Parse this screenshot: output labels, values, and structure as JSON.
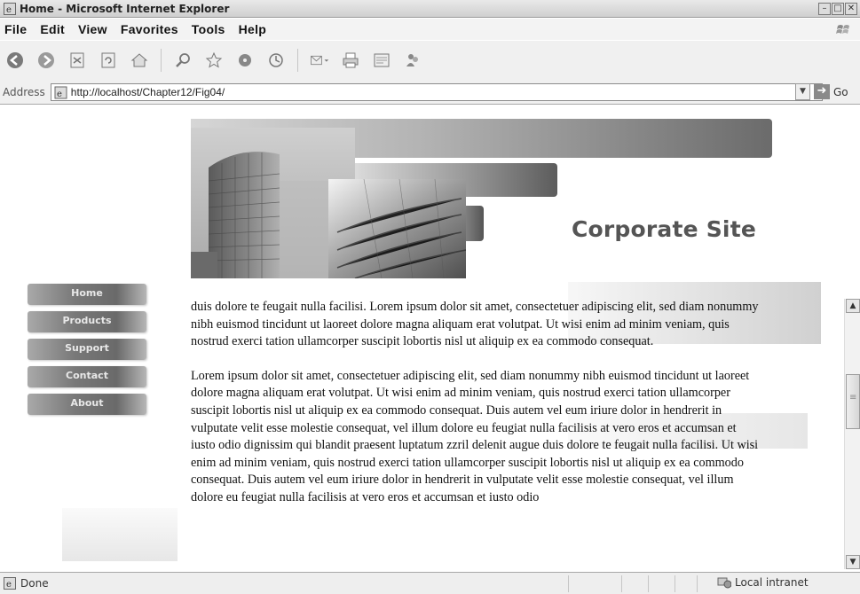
{
  "window": {
    "title": "Home - Microsoft Internet Explorer",
    "controls": [
      "–",
      "□",
      "✕"
    ]
  },
  "menu": [
    "File",
    "Edit",
    "View",
    "Favorites",
    "Tools",
    "Help"
  ],
  "toolbar": {
    "icons": [
      "back-icon",
      "forward-icon",
      "stop-icon",
      "refresh-icon",
      "home-icon",
      "search-icon",
      "favorites-icon",
      "media-icon",
      "history-icon",
      "mail-icon",
      "print-icon",
      "edit-icon",
      "messenger-icon"
    ]
  },
  "address": {
    "label": "Address",
    "url": "http://localhost/Chapter12/Fig04/",
    "go_label": "Go"
  },
  "banner": {
    "title": "Corporate Site"
  },
  "nav": [
    {
      "label": "Home"
    },
    {
      "label": "Products"
    },
    {
      "label": "Support"
    },
    {
      "label": "Contact"
    },
    {
      "label": "About"
    }
  ],
  "content": {
    "paragraphs": [
      "duis dolore te feugait nulla facilisi. Lorem ipsum dolor sit amet, consectetuer adipiscing elit, sed diam nonummy nibh euismod tincidunt ut laoreet dolore magna aliquam erat volutpat. Ut wisi enim ad minim veniam, quis nostrud exerci tation ullamcorper suscipit lobortis nisl ut aliquip ex ea commodo consequat.",
      "Lorem ipsum dolor sit amet, consectetuer adipiscing elit, sed diam nonummy nibh euismod tincidunt ut laoreet dolore magna aliquam erat volutpat. Ut wisi enim ad minim veniam, quis nostrud exerci tation ullamcorper suscipit lobortis nisl ut aliquip ex ea commodo consequat. Duis autem vel eum iriure dolor in hendrerit in vulputate velit esse molestie consequat, vel illum dolore eu feugiat nulla facilisis at vero eros et accumsan et iusto odio dignissim qui blandit praesent luptatum zzril delenit augue duis dolore te feugait nulla facilisi. Ut wisi enim ad minim veniam, quis nostrud exerci tation ullamcorper suscipit lobortis nisl ut aliquip ex ea commodo consequat. Duis autem vel eum iriure dolor in hendrerit in vulputate velit esse molestie consequat, vel illum dolore eu feugiat nulla facilisis at vero eros et accumsan et iusto odio"
    ]
  },
  "status": {
    "text": "Done",
    "zone": "Local intranet"
  }
}
